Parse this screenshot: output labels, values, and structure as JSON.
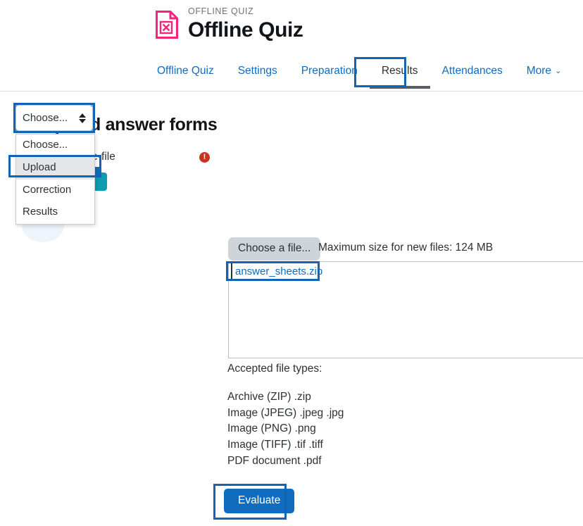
{
  "header": {
    "eyebrow": "OFFLINE QUIZ",
    "title": "Offline Quiz",
    "icon": "offline-quiz-document-icon"
  },
  "nav": {
    "tabs": [
      {
        "label": "Offline Quiz",
        "active": false
      },
      {
        "label": "Settings",
        "active": false
      },
      {
        "label": "Preparation",
        "active": false
      },
      {
        "label": "Results",
        "active": true
      },
      {
        "label": "Attendances",
        "active": false
      },
      {
        "label": "More",
        "active": false,
        "chevron": "⌄"
      }
    ]
  },
  "mode_select": {
    "value": "Choose...",
    "spinner_icon": "up-down-arrows-icon",
    "options": [
      {
        "label": "Choose...",
        "selected": false
      },
      {
        "label": "Upload",
        "selected": true
      },
      {
        "label": "Correction",
        "selected": false
      },
      {
        "label": "Results",
        "selected": false
      }
    ]
  },
  "main": {
    "section_title": "Upload answer forms",
    "field_label": "ZIP- or image-file",
    "required_icon": "required-exclamation-icon",
    "required_icon_glyph": "!",
    "choose_file_label": "Choose a file...",
    "max_size_text": "Maximum size for new files: 124 MB",
    "uploaded_file": "answer_sheets.zip",
    "accepted_title": "Accepted file types:",
    "file_types": [
      "Archive (ZIP) .zip",
      "Image (JPEG) .jpeg .jpg",
      "Image (PNG) .png",
      "Image (TIFF) .tif .tiff",
      "PDF document .pdf"
    ],
    "submit_label": "Evaluate"
  },
  "colors": {
    "link_blue": "#0f6cbf",
    "highlight_blue": "#1364b5",
    "brand_pink": "#f4247c",
    "required_red": "#ca3120",
    "button_grey": "#ced4da",
    "teal": "#0f9bb0"
  }
}
